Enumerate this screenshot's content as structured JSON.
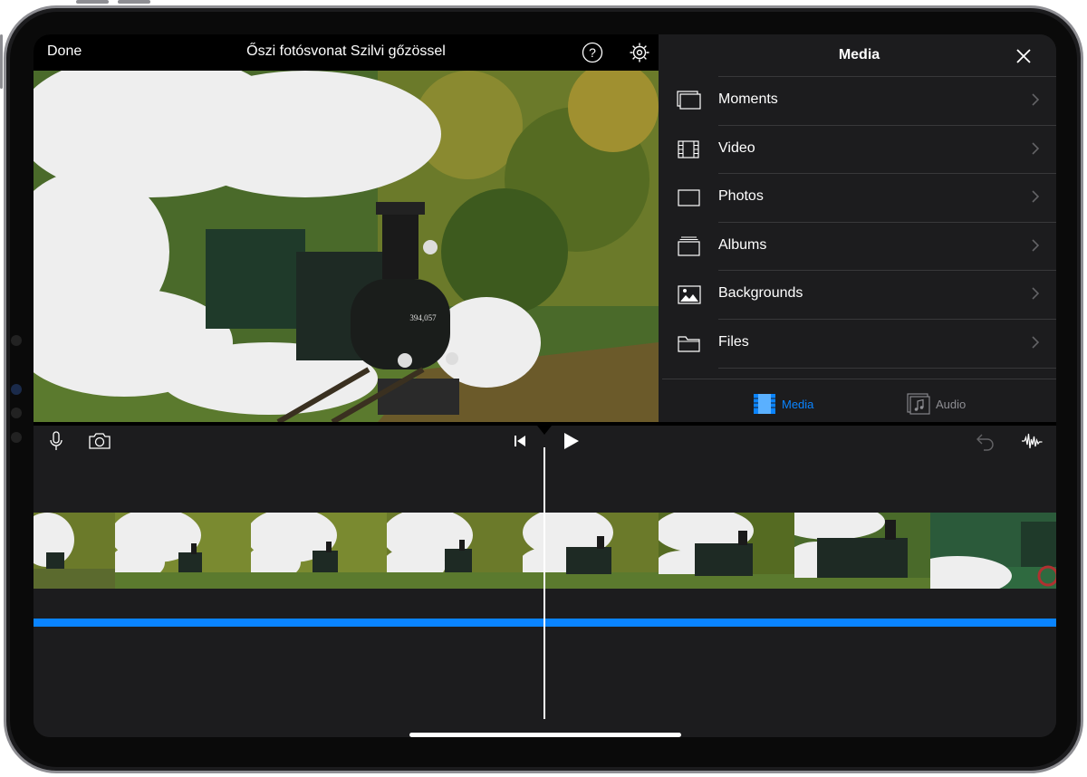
{
  "header": {
    "done_label": "Done",
    "project_title": "Őszi fotósvonat Szilvi gőzössel"
  },
  "media_panel": {
    "title": "Media",
    "items": [
      {
        "label": "Moments",
        "icon": "moments-icon"
      },
      {
        "label": "Video",
        "icon": "film-icon"
      },
      {
        "label": "Photos",
        "icon": "photo-frame-icon"
      },
      {
        "label": "Albums",
        "icon": "albums-icon"
      },
      {
        "label": "Backgrounds",
        "icon": "image-icon"
      },
      {
        "label": "Files",
        "icon": "folder-icon"
      }
    ],
    "tabs": [
      {
        "label": "Media",
        "icon": "film-icon",
        "selected": true
      },
      {
        "label": "Audio",
        "icon": "music-note-icon",
        "selected": false
      }
    ]
  },
  "colors": {
    "accent": "#0a84ff",
    "panel_bg": "#1c1c1e",
    "separator": "#38383a",
    "inactive_text": "#8e8e93"
  }
}
